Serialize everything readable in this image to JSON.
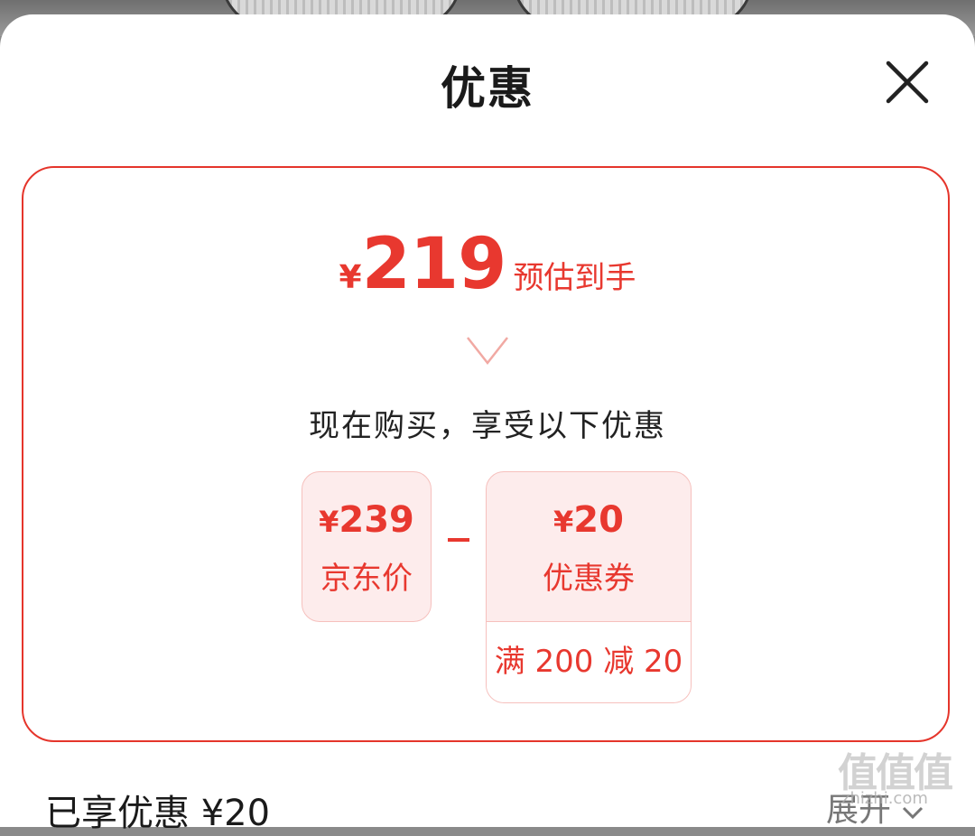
{
  "sheet": {
    "title": "优惠"
  },
  "summary": {
    "currency": "¥",
    "final_price": "219",
    "final_price_label": "预估到手"
  },
  "breakdown": {
    "hint": "现在购买，享受以下优惠",
    "jd_price": {
      "currency": "¥",
      "amount": "239",
      "label": "京东价"
    },
    "operator": "-",
    "coupon": {
      "currency": "¥",
      "amount": "20",
      "label": "优惠券",
      "rule": "满 200 减 20"
    }
  },
  "footer": {
    "enjoyed_label": "已享优惠 ¥20",
    "expand_label": "展开"
  },
  "watermark": {
    "glyphs": "值值值",
    "url": "zhizhi.com"
  },
  "colors": {
    "accent": "#e8382f",
    "card_border": "#e5352b",
    "box_bg": "#fdecec"
  },
  "icons": {
    "close": "close-icon",
    "expand": "chevron-down-icon"
  }
}
